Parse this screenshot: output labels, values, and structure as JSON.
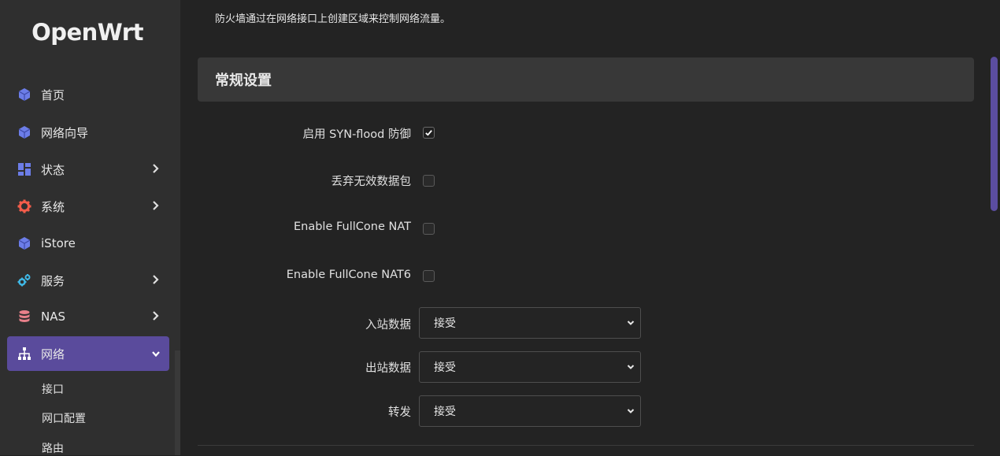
{
  "app": {
    "logo": "OpenWrt"
  },
  "sidebar": {
    "items": [
      {
        "label": "首页",
        "icon": "cube-icon",
        "has_chevron": false
      },
      {
        "label": "网络向导",
        "icon": "cube-icon",
        "has_chevron": false
      },
      {
        "label": "状态",
        "icon": "dashboard-icon",
        "has_chevron": true
      },
      {
        "label": "系统",
        "icon": "gear-icon",
        "has_chevron": true
      },
      {
        "label": "iStore",
        "icon": "cube-icon",
        "has_chevron": false
      },
      {
        "label": "服务",
        "icon": "cogs-icon",
        "has_chevron": true
      },
      {
        "label": "NAS",
        "icon": "database-icon",
        "has_chevron": true
      },
      {
        "label": "网络",
        "icon": "sitemap-icon",
        "has_chevron": true,
        "active": true
      }
    ],
    "subitems": [
      {
        "label": "接口"
      },
      {
        "label": "网口配置"
      },
      {
        "label": "路由"
      }
    ]
  },
  "main": {
    "description": "防火墙通过在网络接口上创建区域来控制网络流量。",
    "section_title": "常规设置",
    "checkboxes": [
      {
        "label": "启用 SYN-flood 防御",
        "checked": true
      },
      {
        "label": "丢弃无效数据包",
        "checked": false
      },
      {
        "label": "Enable FullCone NAT",
        "checked": false
      },
      {
        "label": "Enable FullCone NAT6",
        "checked": false
      }
    ],
    "selects": [
      {
        "label": "入站数据",
        "value": "接受"
      },
      {
        "label": "出站数据",
        "value": "接受"
      },
      {
        "label": "转发",
        "value": "接受"
      }
    ]
  },
  "colors": {
    "accent": "#5a4b9c",
    "icon_blue": "#6c7de8",
    "icon_red": "#f25c4a",
    "icon_cyan": "#3fb8e6",
    "icon_pink": "#e8808a"
  }
}
